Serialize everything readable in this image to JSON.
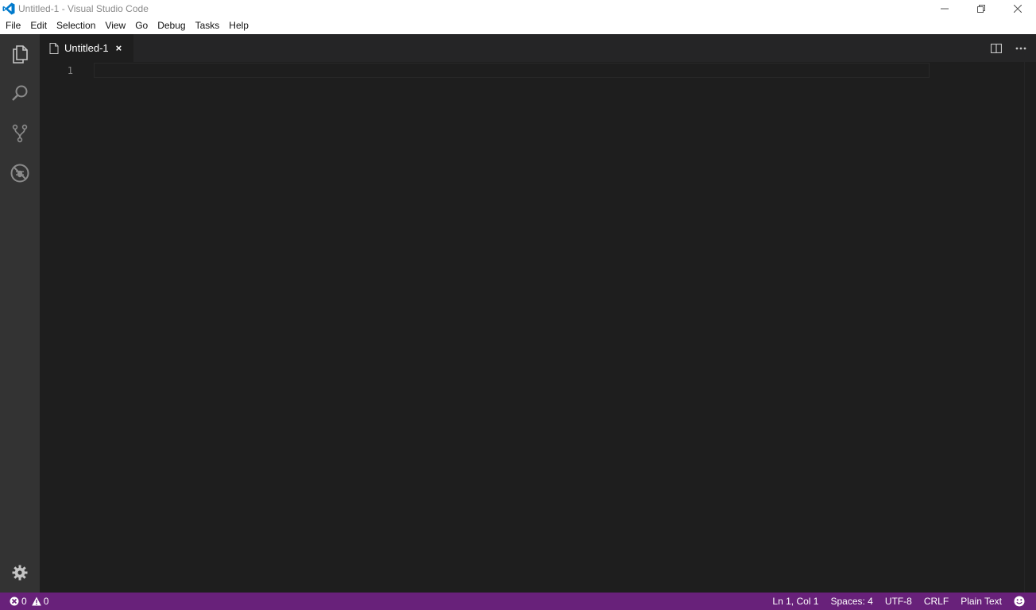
{
  "window": {
    "title": "Untitled-1 - Visual Studio Code",
    "controls": [
      "minimize-icon",
      "restore-icon",
      "close-icon"
    ]
  },
  "menu": {
    "items": [
      "File",
      "Edit",
      "Selection",
      "View",
      "Go",
      "Debug",
      "Tasks",
      "Help"
    ]
  },
  "activity_bar": {
    "items": [
      "explorer-icon",
      "search-icon",
      "source-control-icon",
      "debug-icon"
    ],
    "bottom": "settings-gear-icon"
  },
  "tabs": [
    {
      "label": "Untitled-1",
      "icon": "file-icon",
      "close": "×"
    }
  ],
  "editor_actions": [
    "split-editor-icon",
    "more-actions-icon"
  ],
  "editor": {
    "line_numbers": [
      "1"
    ],
    "content": ""
  },
  "status_bar": {
    "errors": "0",
    "warnings": "0",
    "cursor_position": "Ln 1, Col 1",
    "indentation": "Spaces: 4",
    "encoding": "UTF-8",
    "line_ending": "CRLF",
    "language": "Plain Text",
    "feedback_icon": "smiley-icon"
  },
  "colors": {
    "status_bar": "#68217a",
    "activity_bar": "#333333",
    "editor_bg": "#1e1e1e",
    "tab_bar": "#252526",
    "vscode_blue": "#007acc"
  }
}
